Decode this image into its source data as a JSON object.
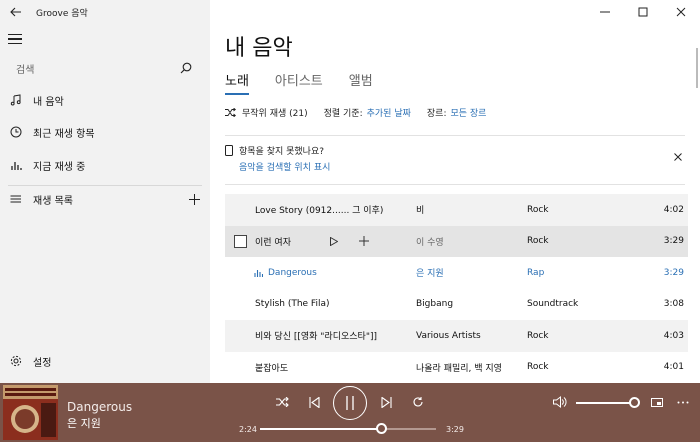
{
  "app": {
    "title": "Groove 음악"
  },
  "sidebar": {
    "search_placeholder": "검색",
    "items": [
      {
        "label": "내 음악",
        "icon": "music-note-icon"
      },
      {
        "label": "최근 재생 항목",
        "icon": "clock-icon"
      },
      {
        "label": "지금 재생 중",
        "icon": "bars-icon"
      }
    ],
    "playlists_label": "재생 목록",
    "settings_label": "설정"
  },
  "main": {
    "title": "내 음악",
    "tabs": [
      {
        "label": "노래",
        "active": true
      },
      {
        "label": "아티스트",
        "active": false
      },
      {
        "label": "앨범",
        "active": false
      }
    ],
    "shuffle_label": "무작위 재생 (21)",
    "sort_label": "정렬 기준:",
    "sort_value": "추가된 날짜",
    "genre_label": "장르:",
    "genre_value": "모든 장르",
    "notice": {
      "text": "항목을 찾지 못했나요?",
      "link": "음악을 검색할 위치 표시"
    },
    "tracks": [
      {
        "title": "Love Story (0912...... 그 이후)",
        "artist": "비",
        "genre": "Rock",
        "duration": "4:02"
      },
      {
        "title": "이런 여자",
        "artist": "이 수영",
        "genre": "Rock",
        "duration": "3:29"
      },
      {
        "title": "Dangerous",
        "artist": "은 지원",
        "genre": "Rap",
        "duration": "3:29"
      },
      {
        "title": "Stylish (The Fila)",
        "artist": "Bigbang",
        "genre": "Soundtrack",
        "duration": "3:08"
      },
      {
        "title": "비와 당신 [[영화 \"라디오스타\"]]",
        "artist": "Various Artists",
        "genre": "Rock",
        "duration": "4:03"
      },
      {
        "title": "붙잡아도",
        "artist": "나올라 패밀리, 백 지영",
        "genre": "Rock",
        "duration": "4:01"
      }
    ]
  },
  "player": {
    "title": "Dangerous",
    "artist": "은 지원",
    "elapsed": "2:24",
    "total": "3:29",
    "progress": 0.69,
    "volume": 1.0,
    "background": "#7a5348",
    "accent": "#2a6fb4"
  }
}
